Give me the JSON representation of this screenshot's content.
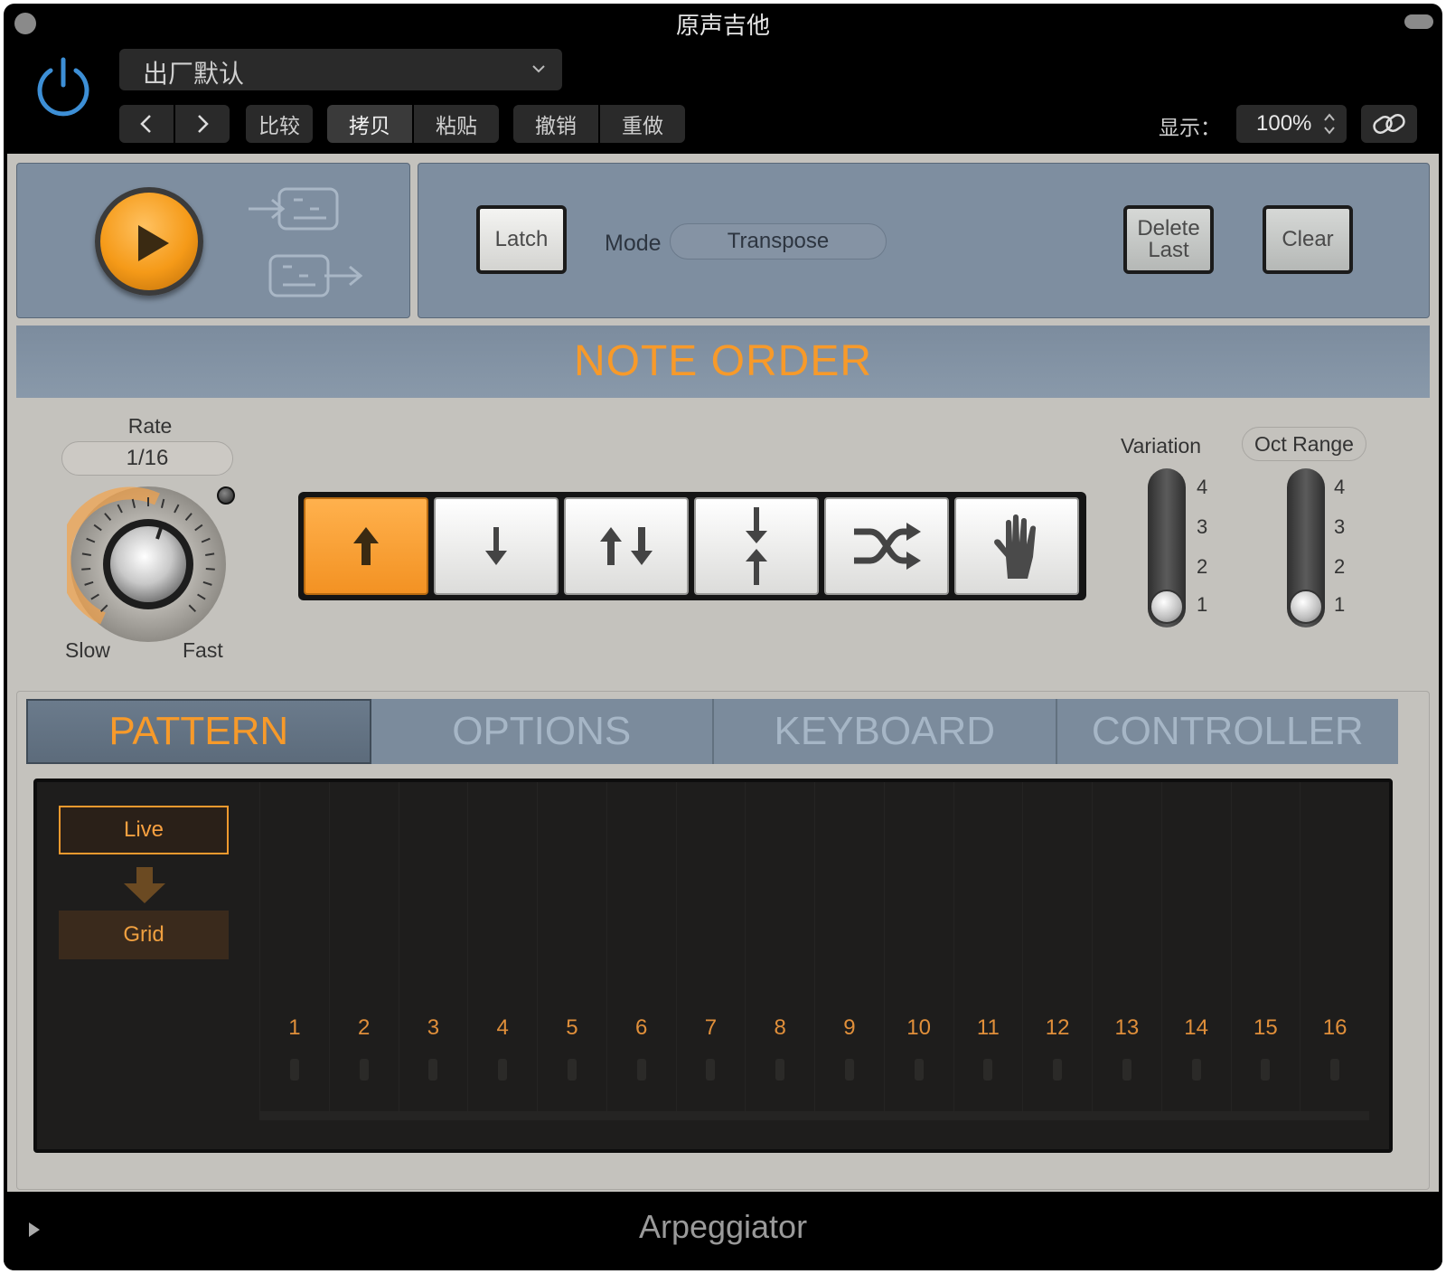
{
  "window": {
    "title": "原声吉他"
  },
  "header": {
    "preset": "出厂默认",
    "buttons": {
      "prev": "<",
      "next": ">",
      "compare": "比较",
      "copy": "拷贝",
      "paste": "粘贴",
      "undo": "撤销",
      "redo": "重做"
    },
    "show_label": "显示：",
    "zoom": "100%"
  },
  "transport": {
    "latch": "Latch",
    "mode_label": "Mode",
    "mode_value": "Transpose",
    "delete_last": "Delete Last",
    "clear": "Clear"
  },
  "note_order": {
    "title": "NOTE ORDER",
    "rate_label": "Rate",
    "rate_value": "1/16",
    "slow": "Slow",
    "fast": "Fast",
    "order_buttons": [
      {
        "name": "up-icon",
        "active": true
      },
      {
        "name": "down-icon",
        "active": false
      },
      {
        "name": "up-down-icon",
        "active": false
      },
      {
        "name": "outside-in-icon",
        "active": false
      },
      {
        "name": "random-icon",
        "active": false
      },
      {
        "name": "manual-hand-icon",
        "active": false
      }
    ],
    "variation_label": "Variation",
    "variation_ticks": [
      "4",
      "3",
      "2",
      "1"
    ],
    "variation_value": 1,
    "oct_range_label": "Oct Range",
    "oct_range_ticks": [
      "4",
      "3",
      "2",
      "1"
    ],
    "oct_range_value": 1
  },
  "tabs": [
    "PATTERN",
    "OPTIONS",
    "KEYBOARD",
    "CONTROLLER"
  ],
  "active_tab": "PATTERN",
  "pattern": {
    "live": "Live",
    "grid": "Grid",
    "steps": [
      "1",
      "2",
      "3",
      "4",
      "5",
      "6",
      "7",
      "8",
      "9",
      "10",
      "11",
      "12",
      "13",
      "14",
      "15",
      "16"
    ]
  },
  "footer": {
    "title": "Arpeggiator"
  },
  "colors": {
    "accent": "#f79a2a",
    "panel": "#7e8ea0",
    "body": "#c4c2bd"
  }
}
